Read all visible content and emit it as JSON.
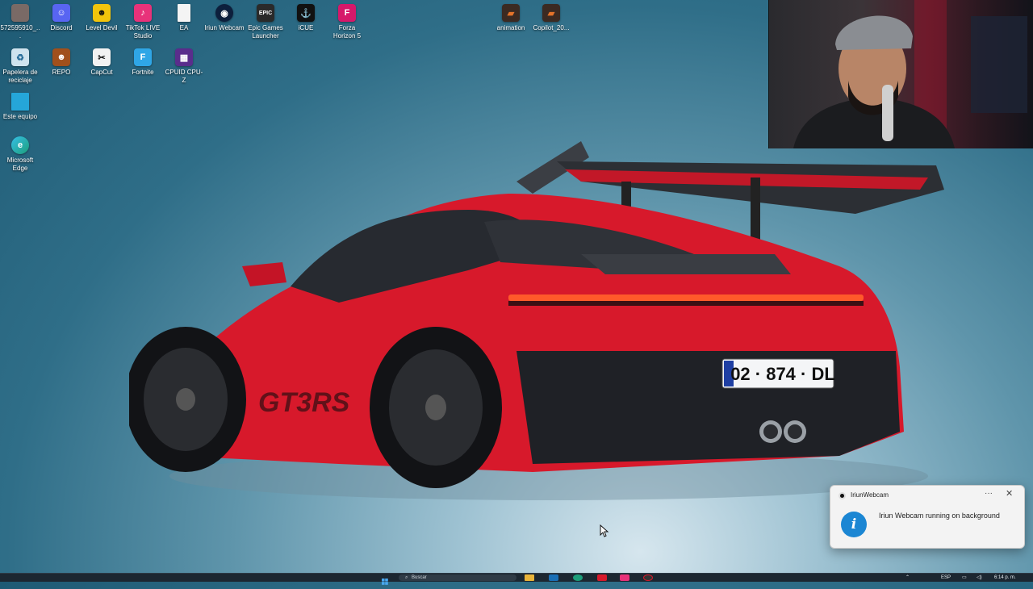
{
  "desktop": {
    "icons": [
      {
        "label": "572595910_...",
        "icon": "photo-icon",
        "color": "#7a6a66"
      },
      {
        "label": "Discord",
        "icon": "discord-icon",
        "color": "#5865f2"
      },
      {
        "label": "Level Devil",
        "icon": "game-icon",
        "color": "#f2c40c"
      },
      {
        "label": "TikTok LIVE Studio",
        "icon": "tiktok-icon",
        "color": "#e8327a"
      },
      {
        "label": "EA",
        "icon": "file-icon",
        "color": "#f4f4f4"
      },
      {
        "label": "Iriun Webcam",
        "icon": "webcam-icon",
        "color": "#0d1f3c"
      },
      {
        "label": "Epic Games Launcher",
        "icon": "epic-games-icon",
        "color": "#2a2a2a"
      },
      {
        "label": "iCUE",
        "icon": "icue-icon",
        "color": "#111111"
      },
      {
        "label": "Forza Horizon 5",
        "icon": "forza-icon",
        "color": "#d6186a"
      },
      {
        "label": "animation",
        "icon": "folder-icon",
        "color": "#3b2a22"
      },
      {
        "label": "Copilot_20...",
        "icon": "folder-icon",
        "color": "#3b2a22"
      },
      {
        "label": "Papelera de reciclaje",
        "icon": "recycle-bin-icon",
        "color": "#cfe3ee"
      },
      {
        "label": "REPO",
        "icon": "game-icon",
        "color": "#a1501c"
      },
      {
        "label": "CapCut",
        "icon": "capcut-icon",
        "color": "#f2f2f2"
      },
      {
        "label": "Fortnite",
        "icon": "fortnite-icon",
        "color": "#2fa6e6"
      },
      {
        "label": "CPUID CPU-Z",
        "icon": "cpu-z-icon",
        "color": "#5a2d8c"
      },
      {
        "label": "Este equipo",
        "icon": "computer-icon",
        "color": "#25a6d9"
      },
      {
        "label": "Microsoft Edge",
        "icon": "edge-icon",
        "color": "#1c9e7a"
      }
    ],
    "wallpaper": {
      "plate_text": "02 · 874 · DL",
      "badge_text": "GT3RS",
      "car_color": "#d7192b"
    }
  },
  "notification": {
    "app_name": "IriunWebcam",
    "message": "Iriun Webcam running on background",
    "more_label": "···",
    "close_label": "✕",
    "info_glyph": "i"
  },
  "taskbar": {
    "search_placeholder": "Buscar",
    "language": "ESP",
    "time": "6:14 p. m."
  }
}
